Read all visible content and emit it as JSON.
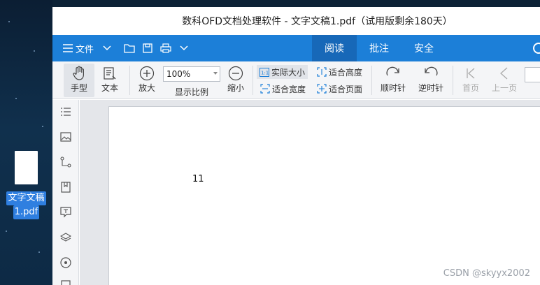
{
  "desktop": {
    "file_label_line1": "文字文稿",
    "file_label_line2": "1.pdf"
  },
  "window": {
    "title": "数科OFD文档处理软件 - 文字文稿1.pdf（试用版剩余180天）"
  },
  "menubar": {
    "file_label": "文件",
    "tabs": [
      {
        "label": "阅读",
        "active": true
      },
      {
        "label": "批注",
        "active": false
      },
      {
        "label": "安全",
        "active": false
      }
    ],
    "accent_color": "#1c7fd8",
    "active_tab_color": "#1768b8"
  },
  "toolbar": {
    "hand": "手型",
    "text": "文本",
    "zoom_in": "放大",
    "zoom_value": "100%",
    "zoom_ratio": "显示比例",
    "zoom_out": "缩小",
    "actual_size": "实际大小",
    "fit_height": "适合高度",
    "fit_width": "适合宽度",
    "fit_page": "适合页面",
    "rotate_cw": "顺时针",
    "rotate_ccw": "逆时针",
    "first_page": "首页",
    "prev_page": "上一页"
  },
  "document": {
    "page_text": "11"
  },
  "watermark": "CSDN @skyyx2002"
}
